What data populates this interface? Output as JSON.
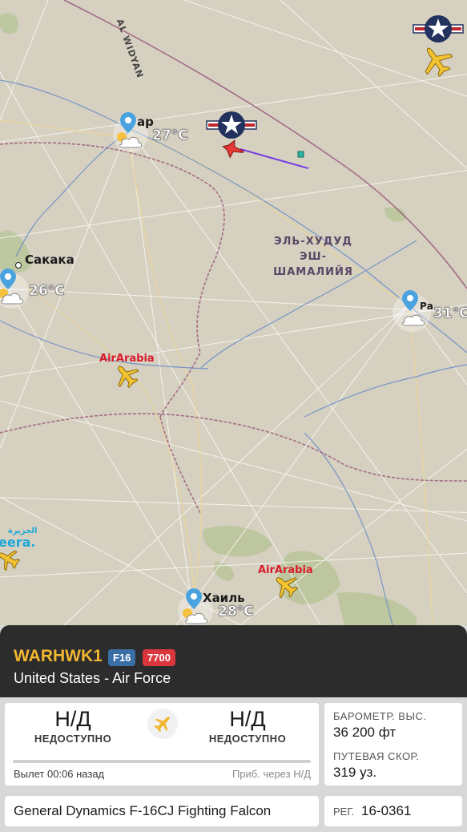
{
  "map": {
    "road_label": "AL WIDYAN",
    "region_label": [
      "ЭЛЬ-ХУДУД",
      "ЭШ-",
      "ШАМАЛИЙЯ"
    ],
    "cities": [
      {
        "name": "ар",
        "temperature": "27°C"
      },
      {
        "name": "Сакака",
        "temperature": "26°C"
      },
      {
        "name": "Ра",
        "temperature": "31°C"
      },
      {
        "name": "Хаиль",
        "temperature": "28°C"
      }
    ],
    "airlines": [
      "AirArabia",
      "AirArabia"
    ],
    "jazeera_logo": "eera.",
    "jazeera_arabic": "الجزيرة",
    "icons": [
      "usaf-roundel-icon",
      "fighter-jet-icon",
      "airplane-icon",
      "weather-cloud-sun-icon",
      "location-pin-icon"
    ],
    "colors": {
      "track": "#7b3fe0",
      "selected_aircraft": "#e53935",
      "aircraft": "#f2c230",
      "border": "#9a5c7a",
      "water": "#6b8fc7"
    }
  },
  "flight": {
    "callsign": "WARHWK1",
    "type_badge": "F16",
    "squawk_badge": "7700",
    "operator": "United States - Air Force",
    "origin_code": "Н/Д",
    "origin_status": "НЕДОСТУПНО",
    "destination_code": "Н/Д",
    "destination_status": "НЕДОСТУПНО",
    "departure_text": "Вылет 00:06 назад",
    "arrival_text": "Приб. через Н/Д",
    "baro_alt_label": "БАРОМЕТР. ВЫС.",
    "baro_alt_value": "36 200 фт",
    "ground_speed_label": "ПУТЕВАЯ СКОР.",
    "ground_speed_value": "319 уз.",
    "aircraft_name": "General Dynamics F-16CJ Fighting Falcon",
    "reg_label": "РЕГ.",
    "reg_value": "16-0361",
    "colors": {
      "callsign": "#f2b632",
      "type_badge": "#3a6fa6",
      "squawk_badge": "#d9363e"
    }
  }
}
